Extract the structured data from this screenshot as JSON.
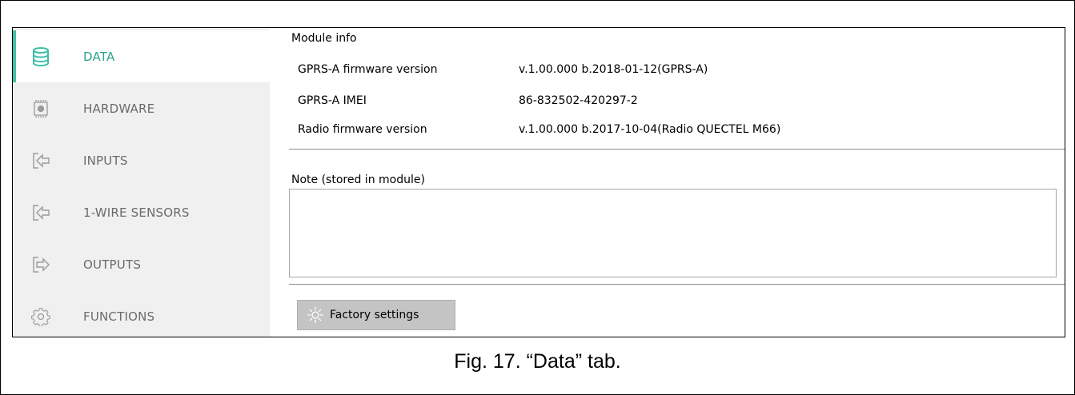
{
  "sidebar": {
    "accent_color": "#3fbfa8",
    "items": [
      {
        "label": "DATA",
        "icon": "database-icon",
        "active": true
      },
      {
        "label": "HARDWARE",
        "icon": "chip-icon",
        "active": false
      },
      {
        "label": "INPUTS",
        "icon": "input-icon",
        "active": false
      },
      {
        "label": "1-WIRE SENSORS",
        "icon": "input-icon",
        "active": false
      },
      {
        "label": "OUTPUTS",
        "icon": "output-icon",
        "active": false
      },
      {
        "label": "FUNCTIONS",
        "icon": "gear-icon",
        "active": false
      }
    ]
  },
  "module_info": {
    "title": "Module info",
    "rows": [
      {
        "key": "GPRS-A firmware version",
        "value": "v.1.00.000 b.2018-01-12(GPRS-A)"
      },
      {
        "key": "GPRS-A IMEI",
        "value": "86-832502-420297-2"
      },
      {
        "key": "Radio firmware version",
        "value": "v.1.00.000 b.2017-10-04(Radio QUECTEL M66)"
      }
    ]
  },
  "note": {
    "label": "Note (stored in module)",
    "value": ""
  },
  "factory_button": {
    "label": "Factory settings",
    "icon": "gear-wrench-icon"
  },
  "caption": "Fig. 17. “Data” tab."
}
